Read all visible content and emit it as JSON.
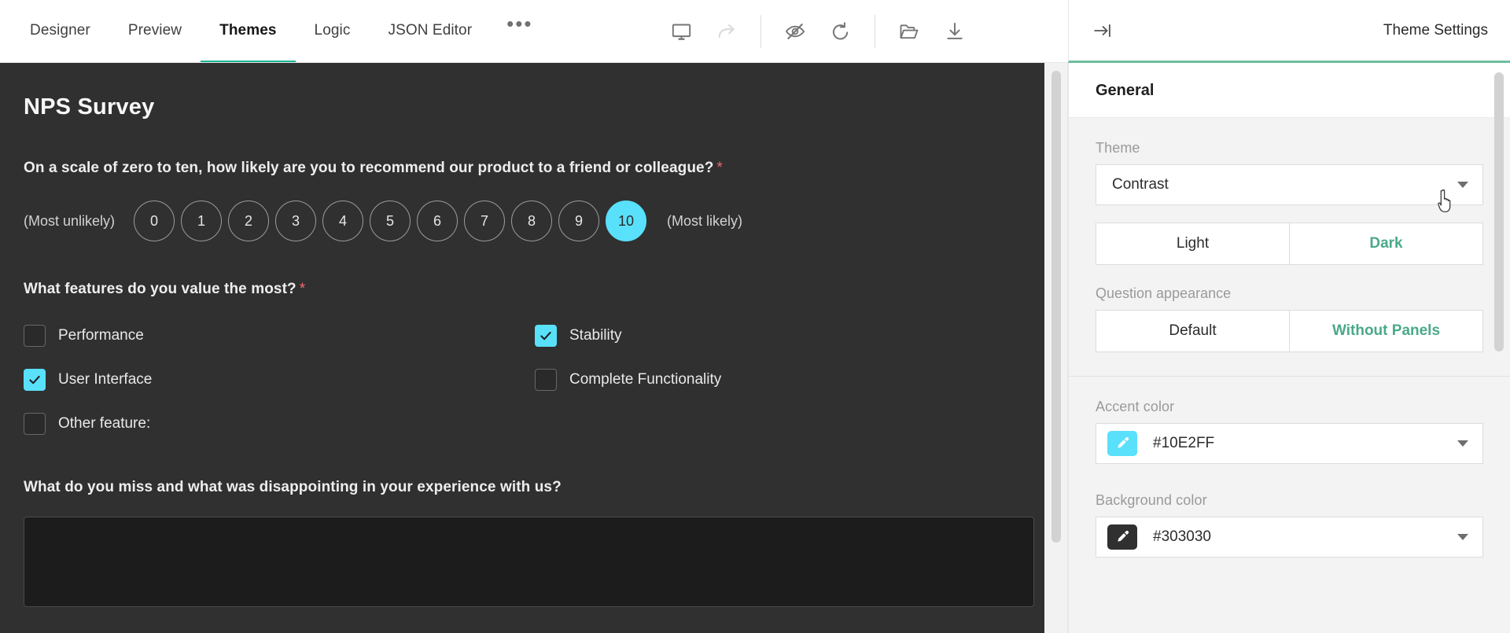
{
  "topbar": {
    "tabs": [
      {
        "label": "Designer",
        "active": false
      },
      {
        "label": "Preview",
        "active": false
      },
      {
        "label": "Themes",
        "active": true
      },
      {
        "label": "Logic",
        "active": false
      },
      {
        "label": "JSON Editor",
        "active": false
      }
    ],
    "overflow_label": "•••",
    "tools": [
      {
        "name": "device-preview-icon",
        "title": "Device preview"
      },
      {
        "name": "redo-icon",
        "title": "Redo",
        "disabled": true
      },
      {
        "name": "preview-hidden-icon",
        "title": "Show invisible elements"
      },
      {
        "name": "reset-icon",
        "title": "Reset"
      },
      {
        "name": "open-file-icon",
        "title": "Open file"
      },
      {
        "name": "download-icon",
        "title": "Download"
      }
    ]
  },
  "panel": {
    "title": "Theme Settings",
    "collapse_icon": "collapse-right-icon",
    "section_title": "General",
    "theme": {
      "label": "Theme",
      "value": "Contrast",
      "options": [
        "Contrast"
      ]
    },
    "mode": {
      "options": [
        {
          "label": "Light",
          "active": false
        },
        {
          "label": "Dark",
          "active": true
        }
      ]
    },
    "question_appearance": {
      "label": "Question appearance",
      "options": [
        {
          "label": "Default",
          "active": false
        },
        {
          "label": "Without Panels",
          "active": true
        }
      ]
    },
    "accent_color": {
      "label": "Accent color",
      "value": "#10E2FF",
      "swatch": "#59e0fb",
      "icon": "eyedropper-icon"
    },
    "background_color": {
      "label": "Background color",
      "value": "#303030",
      "swatch": "#303030",
      "icon": "eyedropper-icon"
    }
  },
  "survey": {
    "title": "NPS Survey",
    "background": "#303030",
    "accent": "#59e0fb",
    "required_mark": "*",
    "nps": {
      "question": "On a scale of zero to ten, how likely are you to recommend our product to a friend or colleague?",
      "min_label": "(Most unlikely)",
      "max_label": "(Most likely)",
      "items": [
        "0",
        "1",
        "2",
        "3",
        "4",
        "5",
        "6",
        "7",
        "8",
        "9",
        "10"
      ],
      "selected": "10"
    },
    "features": {
      "question": "What features do you value the most?",
      "items": [
        {
          "label": "Performance",
          "checked": false
        },
        {
          "label": "Stability",
          "checked": true
        },
        {
          "label": "User Interface",
          "checked": true
        },
        {
          "label": "Complete Functionality",
          "checked": false
        },
        {
          "label": "Other feature:",
          "checked": false
        }
      ]
    },
    "comment": {
      "question": "What do you miss and what was disappointing in your experience with us?",
      "value": ""
    }
  }
}
